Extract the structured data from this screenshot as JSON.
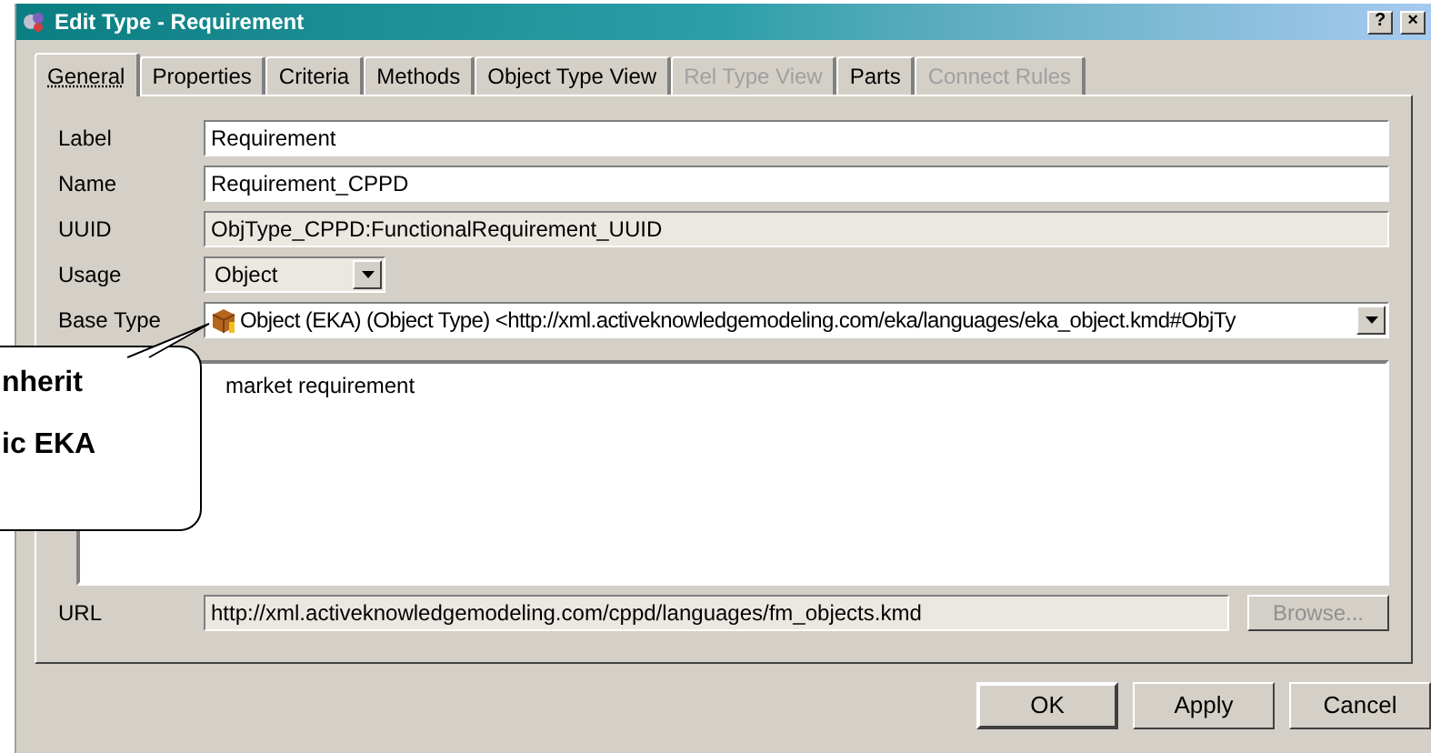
{
  "window": {
    "title": "Edit Type - Requirement",
    "buttons": [
      "?",
      "×"
    ]
  },
  "tabs": [
    {
      "label": "General",
      "selected": true,
      "disabled": false
    },
    {
      "label": "Properties",
      "selected": false,
      "disabled": false
    },
    {
      "label": "Criteria",
      "selected": false,
      "disabled": false
    },
    {
      "label": "Methods",
      "selected": false,
      "disabled": false
    },
    {
      "label": "Object Type View",
      "selected": false,
      "disabled": false
    },
    {
      "label": "Rel Type View",
      "selected": false,
      "disabled": true
    },
    {
      "label": "Parts",
      "selected": false,
      "disabled": false
    },
    {
      "label": "Connect Rules",
      "selected": false,
      "disabled": true
    }
  ],
  "fields": [
    {
      "kind": "text",
      "label": "Label",
      "value": "Requirement",
      "disabled": false
    },
    {
      "kind": "text",
      "label": "Name",
      "value": "Requirement_CPPD",
      "disabled": false
    },
    {
      "kind": "text",
      "label": "UUID",
      "value": "ObjType_CPPD:FunctionalRequirement_UUID",
      "disabled": true
    },
    {
      "kind": "select",
      "label": "Usage",
      "value": "Object"
    },
    {
      "kind": "combo",
      "label": "Base Type",
      "value": "Object (EKA) (Object Type) <http://xml.activeknowledgemodeling.com/eka/languages/eka_object.kmd#ObjTy"
    }
  ],
  "description": {
    "value": "market requirement"
  },
  "url": {
    "label": "URL",
    "value": "http://xml.activeknowledgemodeling.com/cppd/languages/fm_objects.kmd",
    "button": "Browse...",
    "button_disabled": true
  },
  "buttons": [
    "OK",
    "Apply",
    "Cancel"
  ],
  "callout": {
    "lines": [
      "nherit",
      "ic EKA"
    ]
  }
}
